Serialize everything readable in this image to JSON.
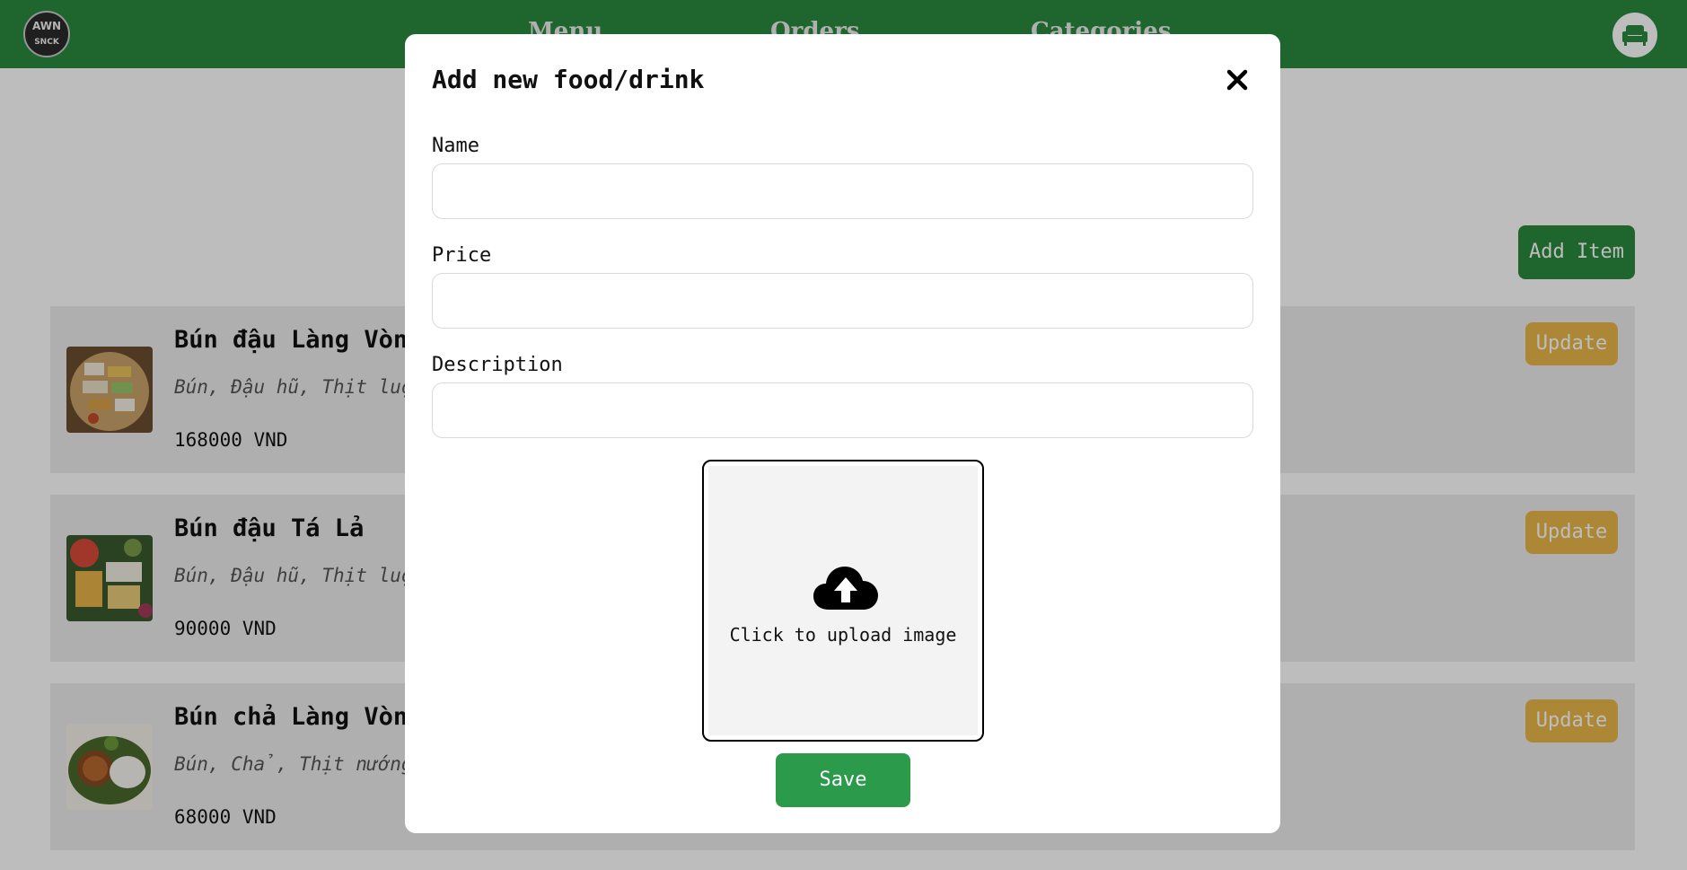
{
  "navbar": {
    "logo_text": "AWN",
    "logo_subtext": "SNCK",
    "links": [
      {
        "label": "Menu"
      },
      {
        "label": "Orders"
      },
      {
        "label": "Categories"
      }
    ],
    "cart_icon": "sofa-icon"
  },
  "page": {
    "add_item_label": "Add Item",
    "items": [
      {
        "name": "Bún đậu Làng Vòng",
        "description": "Bún, Đậu hũ, Thịt luộc",
        "price": "168000 VND",
        "update_label": "Update"
      },
      {
        "name": "Bún đậu Tá Lả",
        "description": "Bún, Đậu hũ, Thịt luộc",
        "price": "90000 VND",
        "update_label": "Update"
      },
      {
        "name": "Bún chả Làng Vòng",
        "description": "Bún, Chả, Thịt nướng",
        "price": "68000 VND",
        "update_label": "Update"
      }
    ]
  },
  "modal": {
    "title": "Add new food/drink",
    "close_icon": "close-icon",
    "fields": {
      "name": {
        "label": "Name",
        "value": ""
      },
      "price": {
        "label": "Price",
        "value": ""
      },
      "description": {
        "label": "Description",
        "value": ""
      }
    },
    "upload_text": "Click to upload image",
    "upload_icon": "cloud-upload-icon",
    "save_label": "Save"
  },
  "colors": {
    "primary_green": "#2b8a3e",
    "save_green": "#2b9a4b",
    "update_yellow": "#e8b84a"
  }
}
